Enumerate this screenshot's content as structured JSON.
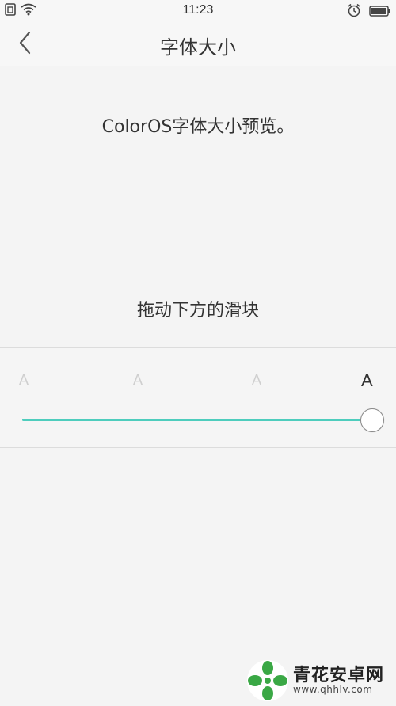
{
  "status_bar": {
    "time": "11:23",
    "left_icons": [
      "sim-icon",
      "wifi-icon"
    ],
    "right_icons": [
      "alarm-icon",
      "battery-icon"
    ]
  },
  "app_bar": {
    "title": "字体大小",
    "back_icon": "back-chevron-icon"
  },
  "preview": {
    "text": "ColorOS字体大小预览。"
  },
  "hint": {
    "text": "拖动下方的滑块"
  },
  "font_size_slider": {
    "labels": [
      "A",
      "A",
      "A",
      "A"
    ],
    "selected_index": 3,
    "accent_color": "#4ecdbd"
  },
  "watermark": {
    "title": "青花安卓网",
    "url": "www.qhhlv.com",
    "logo_color": "#3aa845"
  }
}
